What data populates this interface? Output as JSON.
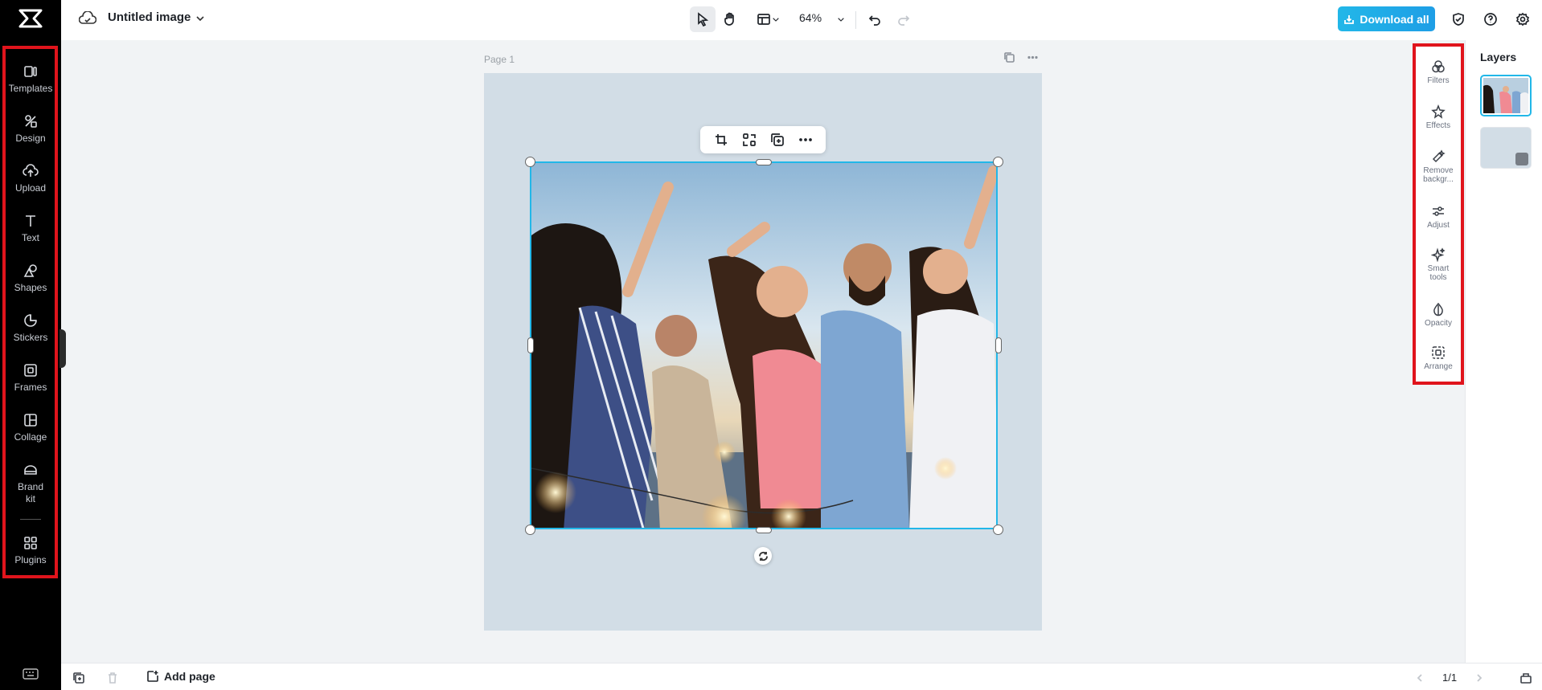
{
  "app": {
    "doc_title": "Untitled image",
    "zoom": "64%",
    "download_label": "Download all",
    "accent": "#22b7e8",
    "highlight": "#e0141c"
  },
  "sidebar": {
    "items": [
      {
        "label": "Templates",
        "icon": "templates-icon"
      },
      {
        "label": "Design",
        "icon": "design-icon"
      },
      {
        "label": "Upload",
        "icon": "upload-icon"
      },
      {
        "label": "Text",
        "icon": "text-icon"
      },
      {
        "label": "Shapes",
        "icon": "shapes-icon"
      },
      {
        "label": "Stickers",
        "icon": "stickers-icon"
      },
      {
        "label": "Frames",
        "icon": "frames-icon"
      },
      {
        "label": "Collage",
        "icon": "collage-icon"
      },
      {
        "label_line1": "Brand",
        "label_line2": "kit",
        "icon": "brand-kit-icon"
      },
      {
        "label": "Plugins",
        "icon": "plugins-icon"
      }
    ]
  },
  "canvas": {
    "page_label": "Page 1"
  },
  "right_tools": {
    "items": [
      {
        "label": "Filters"
      },
      {
        "label": "Effects"
      },
      {
        "label_line1": "Remove",
        "label_line2": "backgr..."
      },
      {
        "label": "Adjust"
      },
      {
        "label_line1": "Smart",
        "label_line2": "tools"
      },
      {
        "label": "Opacity"
      },
      {
        "label": "Arrange"
      }
    ]
  },
  "layers": {
    "title": "Layers"
  },
  "bottom": {
    "add_page": "Add page",
    "page_indicator": "1/1"
  }
}
